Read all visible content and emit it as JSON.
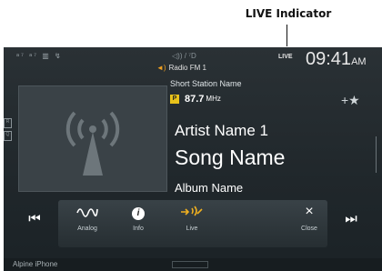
{
  "callout": {
    "label": "LIVE Indicator"
  },
  "status_bar": {
    "icons": "ᵃ⁷ ᵃ⁷ ▥ ↯",
    "volume": "◁)) / ⁷D",
    "live_indicator": "LIVE",
    "time": "09:41",
    "ampm": "AM"
  },
  "source": {
    "label": "Radio FM 1"
  },
  "station": {
    "name": "Short Station Name",
    "preset": "P",
    "frequency": "87.7",
    "unit": "MHz"
  },
  "track": {
    "artist": "Artist Name 1",
    "song": "Song Name",
    "album": "Album Name"
  },
  "controls": {
    "prev": "⏮",
    "next": "⏭",
    "analog_label": "Analog",
    "info_label": "Info",
    "info_glyph": "i",
    "live_label": "Live",
    "close_label": "Close",
    "close_glyph": "×"
  },
  "side": {
    "left_top": "R",
    "left_bottom": "Q"
  },
  "bottom_bar": {
    "device": "Alpine iPhone"
  },
  "colors": {
    "accent": "#f0b020",
    "screen_bg": "#23292d",
    "preset_badge": "#e8c21a"
  }
}
